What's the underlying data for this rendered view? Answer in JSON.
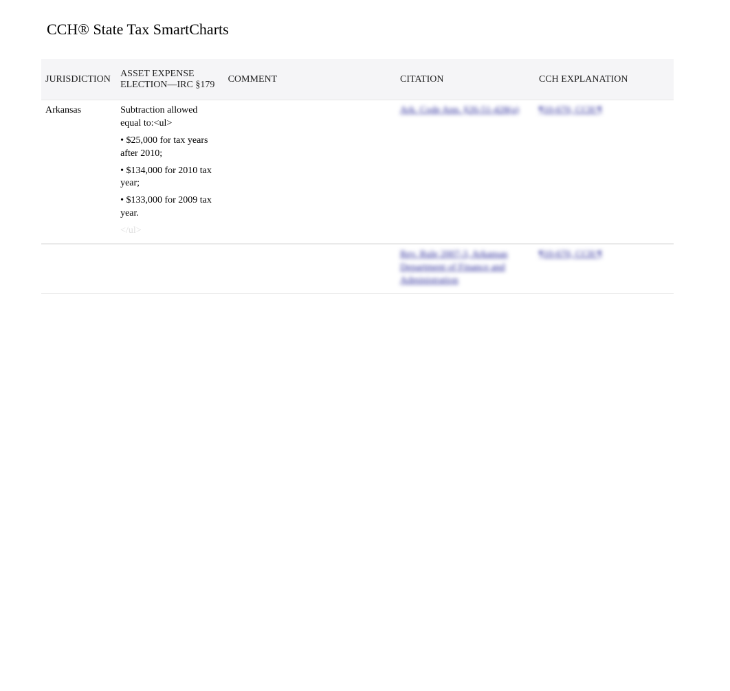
{
  "title": "CCH® State Tax SmartCharts",
  "headers": {
    "jurisdiction": "JURISDICTION",
    "asset_expense": "ASSET EXPENSE ELECTION—IRC §179",
    "comment": "COMMENT",
    "citation": "CITATION",
    "cch_explanation": "CCH EXPLANATION"
  },
  "rows": [
    {
      "jurisdiction": "Arkansas",
      "asset_expense_intro": "Subtraction allowed equal to:<ul>",
      "bullets": [
        " •  $25,000 for tax years after 2010;",
        " •  $134,000 for 2010 tax year;",
        " •  $133,000 for 2009 tax year."
      ],
      "asset_expense_trail": "</ul>",
      "comment": "",
      "citation": "Ark. Code Ann. §26-51-428(a)",
      "cch_explanation": "¶10-670, CCH ¶"
    },
    {
      "jurisdiction": "",
      "asset_expense_intro": "",
      "bullets": [],
      "asset_expense_trail": "",
      "comment": "",
      "citation": "Rev. Rule 2007-3, Arkansas Department of Finance and Administration",
      "cch_explanation": "¶10-670, CCH ¶"
    }
  ]
}
